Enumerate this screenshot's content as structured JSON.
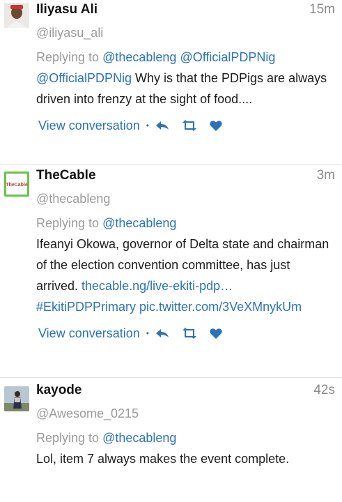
{
  "tweets": [
    {
      "name": "Iliyasu Ali",
      "time": "15m",
      "handle": "@iliyasu_ali",
      "reply_prefix": "Replying to",
      "reply_handles": [
        "@thecableng",
        "@OfficialPDPNig"
      ],
      "body_mention": "@OfficialPDPNig",
      "body_text": " Why is that the PDPigs are always driven into frenzy at the sight of food....",
      "view_label": "View conversation"
    },
    {
      "name": "TheCable",
      "time": "3m",
      "handle": "@thecableng",
      "avatar_text": "TheCable",
      "reply_prefix": "Replying to",
      "reply_handles": [
        "@thecableng"
      ],
      "body_text": "Ifeanyi Okowa, governor of Delta state and chairman of the election convention committee, has just arrived. ",
      "body_link": "thecable.ng/live-ekiti-pdp…",
      "body_hashtag": "#EkitiPDPPrimary",
      "body_pic": "pic.twitter.com/3VeXMnykUm",
      "view_label": "View conversation"
    },
    {
      "name": "kayode",
      "time": "42s",
      "handle": "@Awesome_0215",
      "reply_prefix": "Replying to",
      "reply_handles": [
        "@thecableng"
      ],
      "body_text": "Lol, item 7 always makes the event complete."
    }
  ],
  "colors": {
    "link": "#2a73b8",
    "muted": "#9a9a9a",
    "cable_green": "#6cc04a"
  },
  "icons": [
    "reply-icon",
    "retweet-icon",
    "like-icon"
  ]
}
